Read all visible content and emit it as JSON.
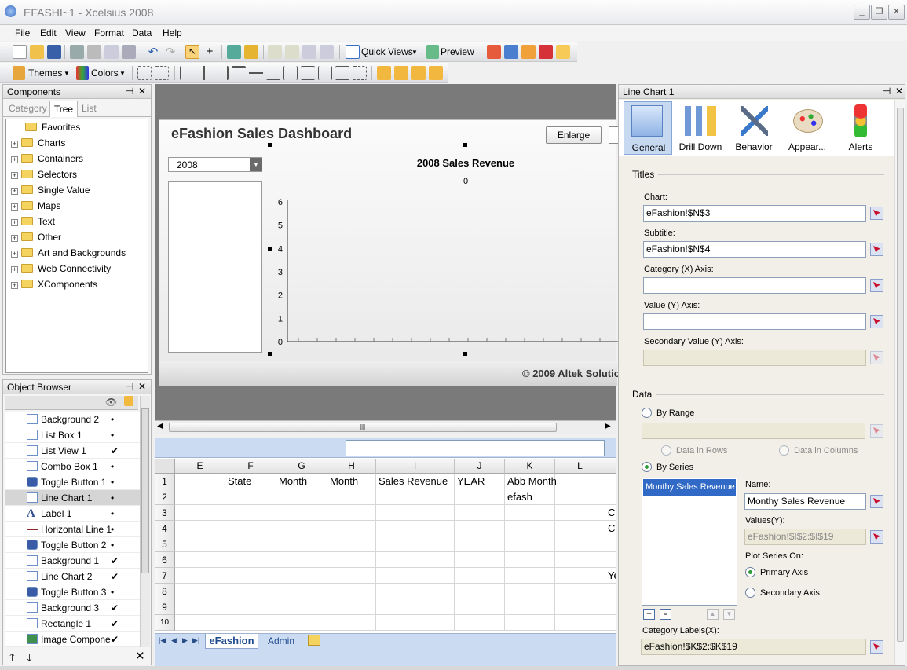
{
  "app": {
    "title": "EFASHI~1 - Xcelsius 2008"
  },
  "menu": [
    "File",
    "Edit",
    "View",
    "Format",
    "Data",
    "Help"
  ],
  "toolbar": {
    "quick_views": "Quick Views",
    "preview": "Preview",
    "themes": "Themes",
    "colors": "Colors"
  },
  "components": {
    "title": "Components",
    "tabs": [
      "Category",
      "Tree",
      "List"
    ],
    "items": [
      "Favorites",
      "Charts",
      "Containers",
      "Selectors",
      "Single Value",
      "Maps",
      "Text",
      "Other",
      "Art and Backgrounds",
      "Web Connectivity",
      "XComponents"
    ]
  },
  "object_browser": {
    "title": "Object Browser",
    "items": [
      {
        "name": "Background 2",
        "check": "•"
      },
      {
        "name": "List Box 1",
        "check": "•"
      },
      {
        "name": "List View 1",
        "check": "✔"
      },
      {
        "name": "Combo Box 1",
        "check": "•"
      },
      {
        "name": "Toggle Button 1",
        "check": "•"
      },
      {
        "name": "Line Chart 1",
        "check": "•"
      },
      {
        "name": "Label 1",
        "check": "•"
      },
      {
        "name": "Horizontal Line 1",
        "check": "•"
      },
      {
        "name": "Toggle Button 2",
        "check": "•"
      },
      {
        "name": "Background 1",
        "check": "✔"
      },
      {
        "name": "Line Chart 2",
        "check": "✔"
      },
      {
        "name": "Toggle Button 3",
        "check": "•"
      },
      {
        "name": "Background 3",
        "check": "✔"
      },
      {
        "name": "Rectangle 1",
        "check": "✔"
      },
      {
        "name": "Image Compone",
        "check": "✔"
      }
    ]
  },
  "canvas": {
    "dashboard_title": "eFashion Sales Dashboard",
    "enlarge": "Enlarge",
    "combo_value": "2008",
    "footer": "© 2009 Altek Solutio"
  },
  "chart_data": {
    "type": "line",
    "title": "2008 Sales Revenue",
    "subtitle": "0",
    "y_ticks": [
      "6",
      "5",
      "4",
      "3",
      "2",
      "1",
      "0"
    ],
    "ylim": [
      0,
      6
    ],
    "series": []
  },
  "sheet": {
    "columns": [
      "E",
      "F",
      "G",
      "H",
      "I",
      "J",
      "K",
      "L"
    ],
    "rows": [
      "1",
      "2",
      "3",
      "4",
      "5",
      "6",
      "7",
      "8",
      "9",
      "10"
    ],
    "row1": {
      "F": "State",
      "G": "Month",
      "H": "Month",
      "I": "Sales Revenue",
      "J": "YEAR",
      "K": "Abb Month"
    },
    "row2": {
      "K": "efash"
    },
    "overflow": {
      "r3": "Ch",
      "r4": "Ch",
      "r7": "Ye"
    },
    "tabs": [
      "eFashion",
      "Admin"
    ]
  },
  "props": {
    "title": "Line Chart 1",
    "tabs": [
      "General",
      "Drill Down",
      "Behavior",
      "Appear...",
      "Alerts"
    ],
    "titles_section": "Titles",
    "chart_label": "Chart:",
    "chart_value": "eFashion!$N$3",
    "subtitle_label": "Subtitle:",
    "subtitle_value": "eFashion!$N$4",
    "cat_axis_label": "Category (X) Axis:",
    "cat_axis_value": "",
    "val_axis_label": "Value (Y) Axis:",
    "val_axis_value": "",
    "sec_axis_label": "Secondary Value (Y) Axis:",
    "data_section": "Data",
    "by_range": "By Range",
    "data_rows": "Data in Rows",
    "data_cols": "Data in Columns",
    "by_series": "By Series",
    "series_item": "Monthy Sales Revenue",
    "name_label": "Name:",
    "name_value": "Monthy Sales Revenue",
    "values_label": "Values(Y):",
    "values_value": "eFashion!$I$2:$I$19",
    "plot_on": "Plot Series On:",
    "primary": "Primary Axis",
    "secondary": "Secondary Axis",
    "cat_labels_label": "Category Labels(X):",
    "cat_labels_value": "eFashion!$K$2:$K$19"
  }
}
